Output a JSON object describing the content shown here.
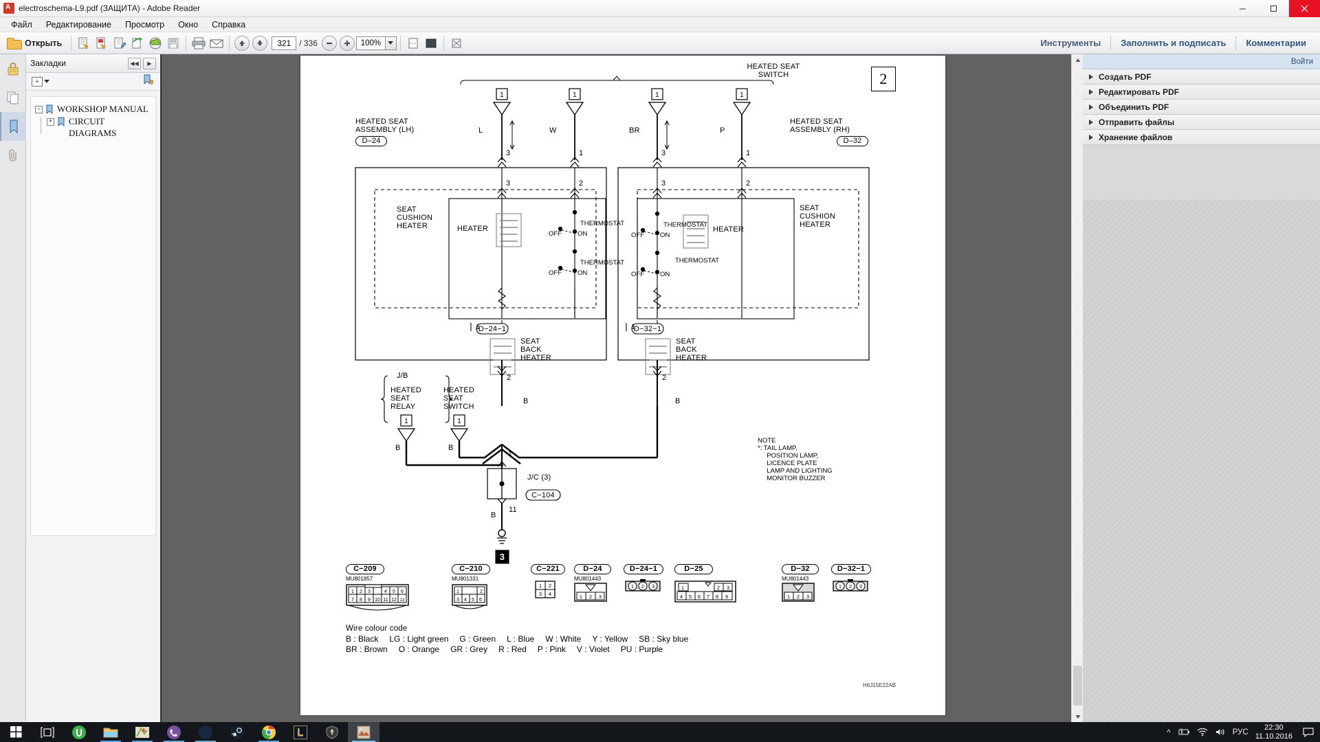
{
  "window": {
    "title": "electroschema-L9.pdf (ЗАЩИТА) - Adobe Reader",
    "app_icon": "pdf-icon",
    "minimize": "–",
    "maximize": "◻",
    "close": "✕"
  },
  "menubar": {
    "items": [
      {
        "label": "Файл"
      },
      {
        "label": "Редактирование"
      },
      {
        "label": "Просмотр"
      },
      {
        "label": "Окно"
      },
      {
        "label": "Справка"
      }
    ]
  },
  "toolbar": {
    "open_label": "Открыть",
    "page_current": "321",
    "page_total": "/ 336",
    "zoom_value": "100%",
    "links": [
      {
        "label": "Инструменты"
      },
      {
        "label": "Заполнить и подписать"
      },
      {
        "label": "Комментарии"
      }
    ]
  },
  "bookmarks": {
    "title": "Закладки",
    "collapse_label": "◀◀",
    "expand_label": "▶",
    "tree": [
      {
        "label": "WORKSHOP MANUAL",
        "expander": "–",
        "level": 0
      },
      {
        "label": "CIRCUIT DIAGRAMS",
        "expander": "+",
        "level": 1
      }
    ]
  },
  "right_panel": {
    "sign_in": "Войти",
    "items": [
      {
        "label": "Создать PDF"
      },
      {
        "label": "Редактировать PDF"
      },
      {
        "label": "Объединить PDF"
      },
      {
        "label": "Отправить файлы"
      },
      {
        "label": "Хранение файлов"
      }
    ]
  },
  "taskbar": {
    "apps": [
      "start-icon",
      "task-view-icon",
      "utorrent-icon",
      "file-explorer-icon",
      "maps-icon",
      "viber-icon",
      "daemon-tools-icon",
      "steam-icon",
      "chrome-icon",
      "league-of-legends-icon",
      "world-of-tanks-icon",
      "adobe-reader-icon"
    ],
    "tray": {
      "chevron": "^",
      "battery": "battery-icon",
      "wifi": "wifi-icon",
      "volume": "volume-icon",
      "language": "РУС",
      "time": "22:30",
      "date": "11.10.2016",
      "notifications": "notification-icon"
    }
  },
  "diagram": {
    "sheet_number": "2",
    "drawing_code": "H6J15E22AB",
    "titles": {
      "heated_seat_switch": "HEATED SEAT\nSWITCH",
      "assembly_lh": "HEATED SEAT\nASSEMBLY (LH)",
      "assembly_lh_connector": "D‒24",
      "assembly_rh": "HEATED SEAT\nASSEMBLY (RH)",
      "assembly_rh_connector": "D‒32",
      "seat_cushion_heater_lh": "SEAT\nCUSHION\nHEATER",
      "seat_cushion_heater_rh": "SEAT\nCUSHION\nHEATER",
      "seat_back_heater_lh": "SEAT\nBACK\nHEATER",
      "seat_back_heater_rh": "SEAT\nBACK\nHEATER",
      "heater_lh": "HEATER",
      "heater_rh": "HEATER",
      "thermostat": "THERMOSTAT",
      "off": "OFF",
      "on": "ON",
      "jb": "J/B",
      "heated_seat_relay": "HEATED\nSEAT\nRELAY",
      "heated_seat_switch_low": "HEATED\nSEAT\nSWITCH",
      "jc3": "J/C (3)",
      "jc3_connector": "C−104",
      "sub_connector_lh": "D−24−1",
      "sub_connector_rh": "D−32−1",
      "ground_ref": "3"
    },
    "wire_labels": {
      "lh_sw_left": "L",
      "lh_sw_right": "W",
      "rh_sw_left": "BR",
      "rh_sw_right": "P",
      "black": "B"
    },
    "pin_numbers": {
      "sw_pin_box": "1",
      "lh_top_left": "3",
      "lh_top_right": "1",
      "rh_top_left": "3",
      "rh_top_right": "1",
      "lh_in_left": "3",
      "lh_in_right": "2",
      "rh_in_left": "3",
      "rh_in_right": "2",
      "lh_mid": "1",
      "rh_mid": "1",
      "lh_out": "2",
      "rh_out": "2",
      "jc_in": "1",
      "jc_out": "11"
    },
    "note": {
      "heading": "NOTE",
      "body": "*: TAIL LAMP,\n     POSITION LAMP,\n     LICENCE PLATE\n     LAMP AND LIGHTING\n     MONITOR BUZZER"
    },
    "connectors": [
      {
        "id": "C−209",
        "part": "MU801857",
        "type": "14pin",
        "rows": [
          [
            "1",
            "2",
            "3",
            "",
            "",
            "4",
            "5",
            "6"
          ],
          [
            "7",
            "8",
            "9",
            "10",
            "11",
            "12",
            "13",
            "14"
          ]
        ]
      },
      {
        "id": "C−210",
        "part": "MU801331",
        "type": "6pin",
        "rows": [
          [
            "1",
            "",
            "2"
          ],
          [
            "3",
            "4",
            "5",
            "6"
          ]
        ]
      },
      {
        "id": "C−221",
        "part": "",
        "type": "4pin",
        "rows": [
          [
            "1",
            "2"
          ],
          [
            "3",
            "4"
          ]
        ]
      },
      {
        "id": "D−24",
        "part": "MU801443",
        "type": "3pin-notch",
        "rows": [
          [
            "1",
            "2",
            "3"
          ]
        ]
      },
      {
        "id": "D−24−1",
        "part": "",
        "type": "3round",
        "rows": [
          [
            "1",
            "2",
            "3"
          ]
        ]
      },
      {
        "id": "D−25",
        "part": "",
        "type": "9pin",
        "rows": [
          [
            "1",
            "",
            "2",
            "3"
          ],
          [
            "4",
            "5",
            "6",
            "7",
            "8",
            "9"
          ]
        ]
      },
      {
        "id": "D−32",
        "part": "MU801443",
        "type": "3pin-notch",
        "rows": [
          [
            "1",
            "2",
            "3"
          ]
        ]
      },
      {
        "id": "D−32−1",
        "part": "",
        "type": "3round",
        "rows": [
          [
            "1",
            "2",
            "3"
          ]
        ]
      }
    ],
    "wire_colour_code": {
      "heading": "Wire colour code",
      "line1": [
        "B : Black",
        "LG : Light green",
        "G : Green",
        "L : Blue",
        "W : White",
        "Y : Yellow",
        "SB : Sky blue"
      ],
      "line2": [
        "BR : Brown",
        "O : Orange",
        "GR : Grey",
        "R : Red",
        "P : Pink",
        "V : Violet",
        "PU : Purple"
      ]
    }
  }
}
